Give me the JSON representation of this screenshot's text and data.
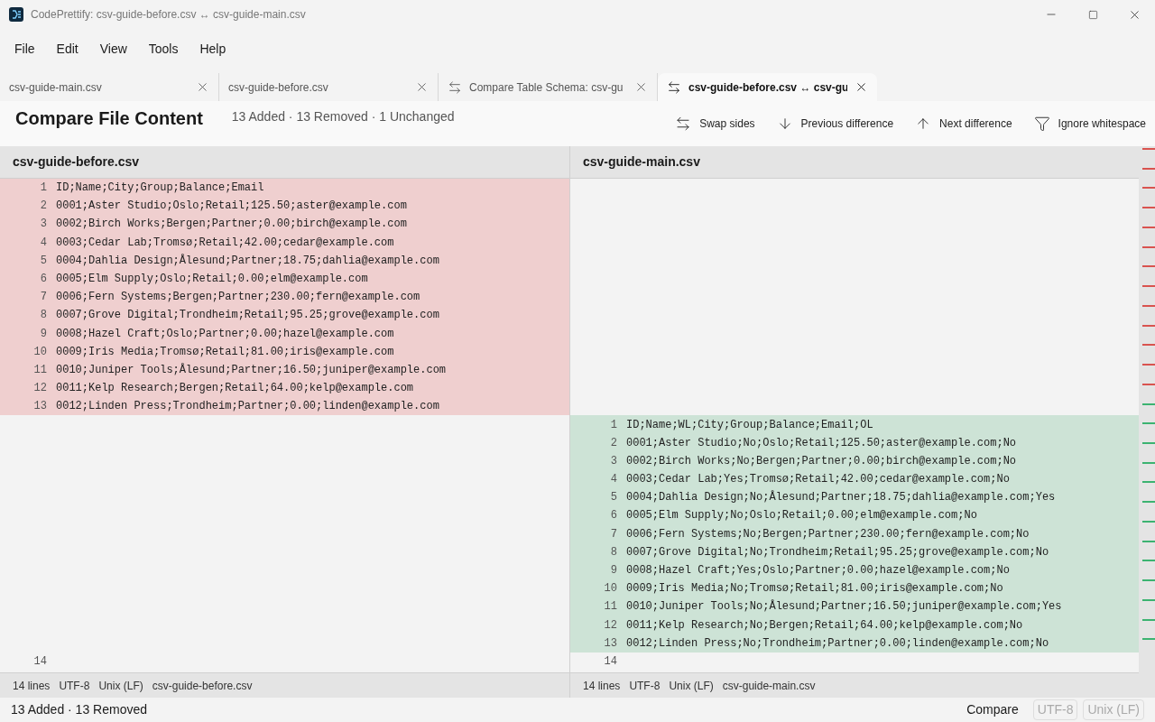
{
  "window": {
    "title": "CodePrettify: csv-guide-before.csv ↔ csv-guide-main.csv"
  },
  "menu": [
    "File",
    "Edit",
    "View",
    "Tools",
    "Help"
  ],
  "tabs": [
    {
      "label": "csv-guide-main.csv",
      "kind": "file",
      "selected": false
    },
    {
      "label": "csv-guide-before.csv",
      "kind": "file",
      "selected": false
    },
    {
      "label": "Compare Table Schema: csv-gu",
      "kind": "compare",
      "selected": false
    },
    {
      "label": "csv-guide-before.csv ↔ csv-gu",
      "kind": "compare",
      "selected": true
    }
  ],
  "header": {
    "title": "Compare File Content",
    "summary": "13 Added · 13 Removed · 1 Unchanged"
  },
  "toolbar": [
    {
      "label": "Swap sides",
      "kind": "swap"
    },
    {
      "label": "Previous difference",
      "kind": "down"
    },
    {
      "label": "Next difference",
      "kind": "up"
    },
    {
      "label": "Ignore whitespace",
      "kind": "filter"
    }
  ],
  "panes": [
    {
      "filename": "csv-guide-before.csv",
      "lines": [
        {
          "kind": "removed",
          "num": "1",
          "text": "ID;Name;City;Group;Balance;Email"
        },
        {
          "kind": "removed",
          "num": "2",
          "text": "0001;Aster Studio;Oslo;Retail;125.50;aster@example.com"
        },
        {
          "kind": "removed",
          "num": "3",
          "text": "0002;Birch Works;Bergen;Partner;0.00;birch@example.com"
        },
        {
          "kind": "removed",
          "num": "4",
          "text": "0003;Cedar Lab;Tromsø;Retail;42.00;cedar@example.com"
        },
        {
          "kind": "removed",
          "num": "5",
          "text": "0004;Dahlia Design;Ålesund;Partner;18.75;dahlia@example.com"
        },
        {
          "kind": "removed",
          "num": "6",
          "text": "0005;Elm Supply;Oslo;Retail;0.00;elm@example.com"
        },
        {
          "kind": "removed",
          "num": "7",
          "text": "0006;Fern Systems;Bergen;Partner;230.00;fern@example.com"
        },
        {
          "kind": "removed",
          "num": "8",
          "text": "0007;Grove Digital;Trondheim;Retail;95.25;grove@example.com"
        },
        {
          "kind": "removed",
          "num": "9",
          "text": "0008;Hazel Craft;Oslo;Partner;0.00;hazel@example.com"
        },
        {
          "kind": "removed",
          "num": "10",
          "text": "0009;Iris Media;Tromsø;Retail;81.00;iris@example.com"
        },
        {
          "kind": "removed",
          "num": "11",
          "text": "0010;Juniper Tools;Ålesund;Partner;16.50;juniper@example.com"
        },
        {
          "kind": "removed",
          "num": "12",
          "text": "0011;Kelp Research;Bergen;Retail;64.00;kelp@example.com"
        },
        {
          "kind": "removed",
          "num": "13",
          "text": "0012;Linden Press;Trondheim;Partner;0.00;linden@example.com"
        },
        {
          "kind": "blank"
        },
        {
          "kind": "blank"
        },
        {
          "kind": "blank"
        },
        {
          "kind": "blank"
        },
        {
          "kind": "blank"
        },
        {
          "kind": "blank"
        },
        {
          "kind": "blank"
        },
        {
          "kind": "blank"
        },
        {
          "kind": "blank"
        },
        {
          "kind": "blank"
        },
        {
          "kind": "blank"
        },
        {
          "kind": "blank"
        },
        {
          "kind": "blank"
        },
        {
          "kind": "context",
          "num": "14"
        }
      ],
      "status": [
        "14 lines",
        "UTF-8",
        "Unix (LF)",
        "csv-guide-before.csv"
      ]
    },
    {
      "filename": "csv-guide-main.csv",
      "lines": [
        {
          "kind": "blank"
        },
        {
          "kind": "blank"
        },
        {
          "kind": "blank"
        },
        {
          "kind": "blank"
        },
        {
          "kind": "blank"
        },
        {
          "kind": "blank"
        },
        {
          "kind": "blank"
        },
        {
          "kind": "blank"
        },
        {
          "kind": "blank"
        },
        {
          "kind": "blank"
        },
        {
          "kind": "blank"
        },
        {
          "kind": "blank"
        },
        {
          "kind": "blank"
        },
        {
          "kind": "added",
          "num": "1",
          "text": "ID;Name;WL;City;Group;Balance;Email;OL"
        },
        {
          "kind": "added",
          "num": "2",
          "text": "0001;Aster Studio;No;Oslo;Retail;125.50;aster@example.com;No"
        },
        {
          "kind": "added",
          "num": "3",
          "text": "0002;Birch Works;No;Bergen;Partner;0.00;birch@example.com;No"
        },
        {
          "kind": "added",
          "num": "4",
          "text": "0003;Cedar Lab;Yes;Tromsø;Retail;42.00;cedar@example.com;No"
        },
        {
          "kind": "added",
          "num": "5",
          "text": "0004;Dahlia Design;No;Ålesund;Partner;18.75;dahlia@example.com;Yes"
        },
        {
          "kind": "added",
          "num": "6",
          "text": "0005;Elm Supply;No;Oslo;Retail;0.00;elm@example.com;No"
        },
        {
          "kind": "added",
          "num": "7",
          "text": "0006;Fern Systems;No;Bergen;Partner;230.00;fern@example.com;No"
        },
        {
          "kind": "added",
          "num": "8",
          "text": "0007;Grove Digital;No;Trondheim;Retail;95.25;grove@example.com;No"
        },
        {
          "kind": "added",
          "num": "9",
          "text": "0008;Hazel Craft;Yes;Oslo;Partner;0.00;hazel@example.com;No"
        },
        {
          "kind": "added",
          "num": "10",
          "text": "0009;Iris Media;No;Tromsø;Retail;81.00;iris@example.com;No"
        },
        {
          "kind": "added",
          "num": "11",
          "text": "0010;Juniper Tools;No;Ålesund;Partner;16.50;juniper@example.com;Yes"
        },
        {
          "kind": "added",
          "num": "12",
          "text": "0011;Kelp Research;No;Bergen;Retail;64.00;kelp@example.com;No"
        },
        {
          "kind": "added",
          "num": "13",
          "text": "0012;Linden Press;No;Trondheim;Partner;0.00;linden@example.com;No"
        },
        {
          "kind": "context",
          "num": "14"
        }
      ],
      "status": [
        "14 lines",
        "UTF-8",
        "Unix (LF)",
        "csv-guide-main.csv"
      ]
    }
  ],
  "status_bar": {
    "summary": "13 Added · 13 Removed",
    "mode": "Compare",
    "badges": [
      {
        "label": "UTF-8",
        "disabled": true
      },
      {
        "label": "Unix (LF)",
        "disabled": true
      }
    ]
  }
}
